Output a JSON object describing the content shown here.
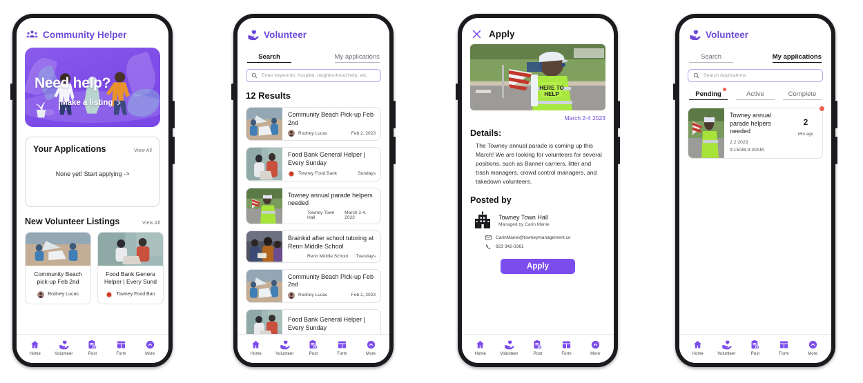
{
  "accent": "#7c4ded",
  "accent_dark": "#6d49d8",
  "badge_red": "#f4604e",
  "nav": {
    "items": [
      {
        "label": "Home",
        "icon": "home-icon"
      },
      {
        "label": "Volunteer",
        "icon": "hand-heart-icon"
      },
      {
        "label": "Post",
        "icon": "clipboard-plus-icon"
      },
      {
        "label": "Form",
        "icon": "grid-form-icon"
      },
      {
        "label": "More",
        "icon": "chevron-up-circle-icon"
      }
    ]
  },
  "phone1": {
    "header": {
      "title": "Community Helper",
      "icon": "people-group-icon"
    },
    "hero": {
      "title": "Need help?",
      "cta": "Make a listing",
      "cta_icon": "chevron-right-icon"
    },
    "applications": {
      "title": "Your Applications",
      "view_all": "View All",
      "empty": "None yet!  Start applying ->"
    },
    "listings_section": {
      "title": "New Volunteer Listings",
      "view_all": "View All"
    },
    "listings": [
      {
        "title_line1": "Community Beach",
        "title_line2": "pick-up Feb 2nd",
        "org": "Rodney Lucas",
        "thumb": "beach-cleanup-photo"
      },
      {
        "title_line1": "Food Bank Genera",
        "title_line2": "Helper | Every Sund",
        "org": "Towney Food Ban",
        "thumb": "food-bank-photo"
      }
    ]
  },
  "phone2": {
    "header": {
      "title": "Volunteer",
      "icon": "hand-heart-icon"
    },
    "tabs": [
      {
        "label": "Search",
        "active": true
      },
      {
        "label": "My applications",
        "active": false
      }
    ],
    "search": {
      "placeholder": "Enter keywords: hospital, neighborhood help, etc",
      "value": ""
    },
    "results_count": "12 Results",
    "results": [
      {
        "title": "Community Beach Pick-up Feb 2nd",
        "org": "Rodney Lucas",
        "when": "Feb 2, 2023",
        "has_avatar": true,
        "thumb": "beach-cleanup-photo"
      },
      {
        "title": "Food Bank General Helper | Every Sunday",
        "org": "Towney Food Bank",
        "when": "Sundays",
        "has_avatar": true,
        "thumb": "food-bank-photo"
      },
      {
        "title": "Towney annual parade helpers needed",
        "org": "Towney Town Hall",
        "when": "March 2-4, 2023",
        "has_avatar": false,
        "thumb": "parade-volunteer-photo"
      },
      {
        "title": "Brainkid after school tutoring at Renn Middle School",
        "org": "Renn Middle School",
        "when": "Tuesdays",
        "has_avatar": false,
        "thumb": "tutoring-photo"
      },
      {
        "title": "Community Beach Pick-up Feb 2nd",
        "org": "Rodney Lucas",
        "when": "Feb 2, 2023",
        "has_avatar": true,
        "thumb": "beach-cleanup-photo"
      },
      {
        "title": "Food Bank General Helper | Every Sunday",
        "org": "",
        "when": "",
        "has_avatar": true,
        "thumb": "food-bank-photo"
      }
    ]
  },
  "phone3": {
    "header": {
      "title": "Apply",
      "icon": "close-x-icon"
    },
    "photo": "parade-volunteer-photo",
    "photo_date": "March 2-4 2023",
    "details_title": "Details:",
    "details_body": "The Towney annual parade is coming up this March!  We are looking for volunteers for several positions, such as Banner carriers, litter and trash managers, crowd control managers, and takedown volunteers.",
    "posted_by_title": "Posted by",
    "poster": {
      "icon": "town-hall-building-icon",
      "name": "Towney Town Hall",
      "managed_by": "Managed by Carin Manie",
      "email": "CarinManie@towneymanagement.co",
      "email_icon": "mail-icon",
      "phone": "823 342-3361",
      "phone_icon": "phone-icon"
    },
    "apply_label": "Apply"
  },
  "phone4": {
    "header": {
      "title": "Volunteer",
      "icon": "hand-heart-icon"
    },
    "tabs": [
      {
        "label": "Search",
        "active": false
      },
      {
        "label": "My applications",
        "active": true
      }
    ],
    "search": {
      "placeholder": "Search Applications",
      "value": ""
    },
    "filter_tabs": [
      {
        "label": "Pending",
        "active": true,
        "badge": true
      },
      {
        "label": "Active",
        "active": false,
        "badge": false
      },
      {
        "label": "Complete",
        "active": false,
        "badge": false
      }
    ],
    "application": {
      "title": "Towney annual parade helpers needed",
      "date": "2.2 2023",
      "time": "9:15AM-9:30AM",
      "count": "2",
      "ago": "Min ago",
      "thumb": "parade-volunteer-photo"
    }
  }
}
